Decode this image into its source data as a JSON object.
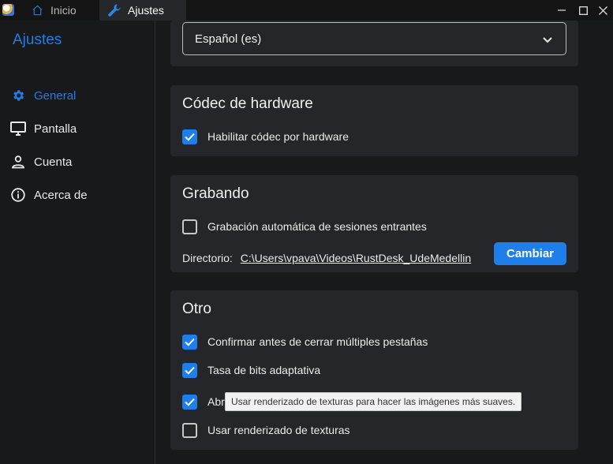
{
  "tabs": {
    "home_label": "Inicio",
    "settings_label": "Ajustes"
  },
  "sidebar": {
    "title": "Ajustes",
    "items": [
      {
        "label": "General",
        "icon": "gear-icon",
        "active": true
      },
      {
        "label": "Pantalla",
        "icon": "monitor-icon",
        "active": false
      },
      {
        "label": "Cuenta",
        "icon": "person-icon",
        "active": false
      },
      {
        "label": "Acerca de",
        "icon": "info-icon",
        "active": false
      }
    ]
  },
  "language": {
    "selected": "Español (es)"
  },
  "hardware_codec": {
    "title": "Códec de hardware",
    "enable_label": "Habilitar códec por hardware",
    "enable_checked": true
  },
  "recording": {
    "title": "Grabando",
    "auto_record_label": "Grabación automática de sesiones entrantes",
    "auto_record_checked": false,
    "directory_label": "Directorio:",
    "directory_path": "C:\\Users\\vpava\\Videos\\RustDesk_UdeMedellin",
    "change_button": "Cambiar"
  },
  "other": {
    "title": "Otro",
    "options": [
      {
        "label": "Confirmar antes de cerrar múltiples pestañas",
        "checked": true
      },
      {
        "label": "Tasa de bits adaptativa",
        "checked": true
      },
      {
        "label": "Abr",
        "checked": true
      },
      {
        "label": "Usar renderizado de texturas",
        "checked": false
      }
    ]
  },
  "tooltip": {
    "text": "Usar renderizado de texturas para hacer las imágenes más suaves."
  },
  "colors": {
    "accent": "#1f7ee8",
    "background": "#18191b",
    "card": "#25262a"
  }
}
